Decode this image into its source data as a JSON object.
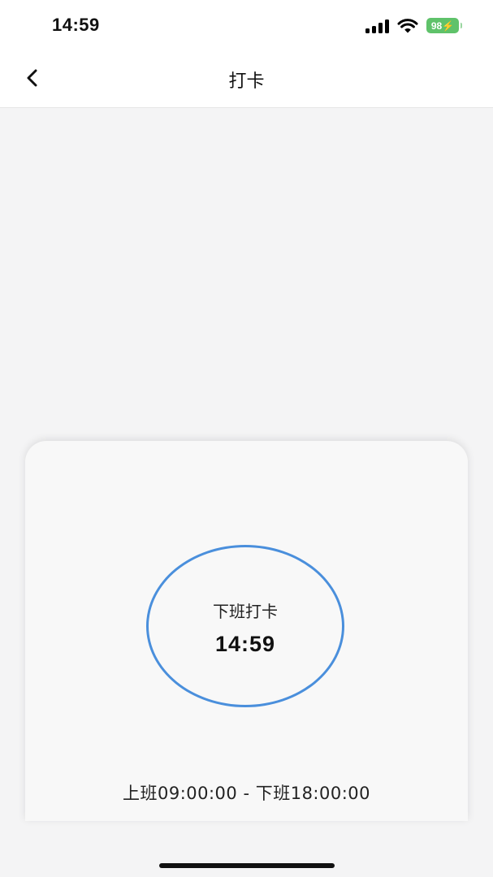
{
  "status_bar": {
    "time": "14:59",
    "battery": "98"
  },
  "header": {
    "title": "打卡"
  },
  "card": {
    "punch_label": "下班打卡",
    "punch_time": "14:59",
    "schedule": "上班09:00:00 - 下班18:00:00"
  },
  "icons": {
    "back": "chevron-left-icon",
    "signal": "signal-icon",
    "wifi": "wifi-icon",
    "battery": "battery-charging-icon"
  },
  "colors": {
    "accent": "#4a8fdc",
    "battery": "#5fc26a"
  }
}
